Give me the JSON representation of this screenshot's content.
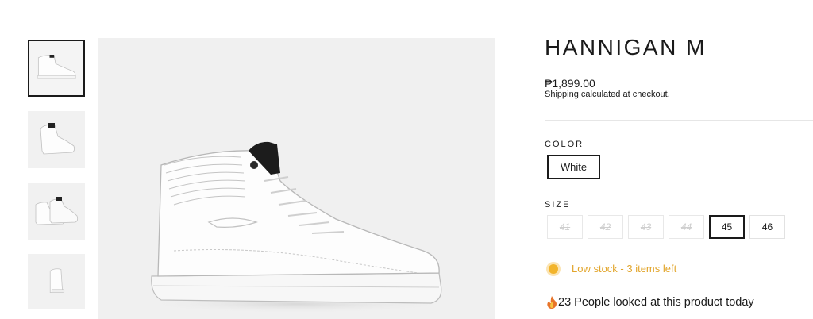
{
  "product": {
    "title": "HANNIGAN M",
    "price": "₱1,899.00",
    "shipping_link": "Shipping",
    "shipping_text": " calculated at checkout."
  },
  "color": {
    "label": "COLOR",
    "selected": "White"
  },
  "size": {
    "label": "SIZE",
    "options": [
      {
        "value": "41",
        "state": "unavailable"
      },
      {
        "value": "42",
        "state": "unavailable"
      },
      {
        "value": "43",
        "state": "unavailable"
      },
      {
        "value": "44",
        "state": "unavailable"
      },
      {
        "value": "45",
        "state": "selected"
      },
      {
        "value": "46",
        "state": "available"
      }
    ]
  },
  "stock": {
    "text": "Low stock - 3 items left",
    "color": "#e2a52b"
  },
  "views": {
    "icon": "fire-icon",
    "text": "23 People looked at this product today"
  },
  "gallery": {
    "thumbnails": [
      "shoe-side-view",
      "shoe-back-view",
      "shoe-pair-view",
      "shoe-rear-view"
    ],
    "active_index": 0
  }
}
